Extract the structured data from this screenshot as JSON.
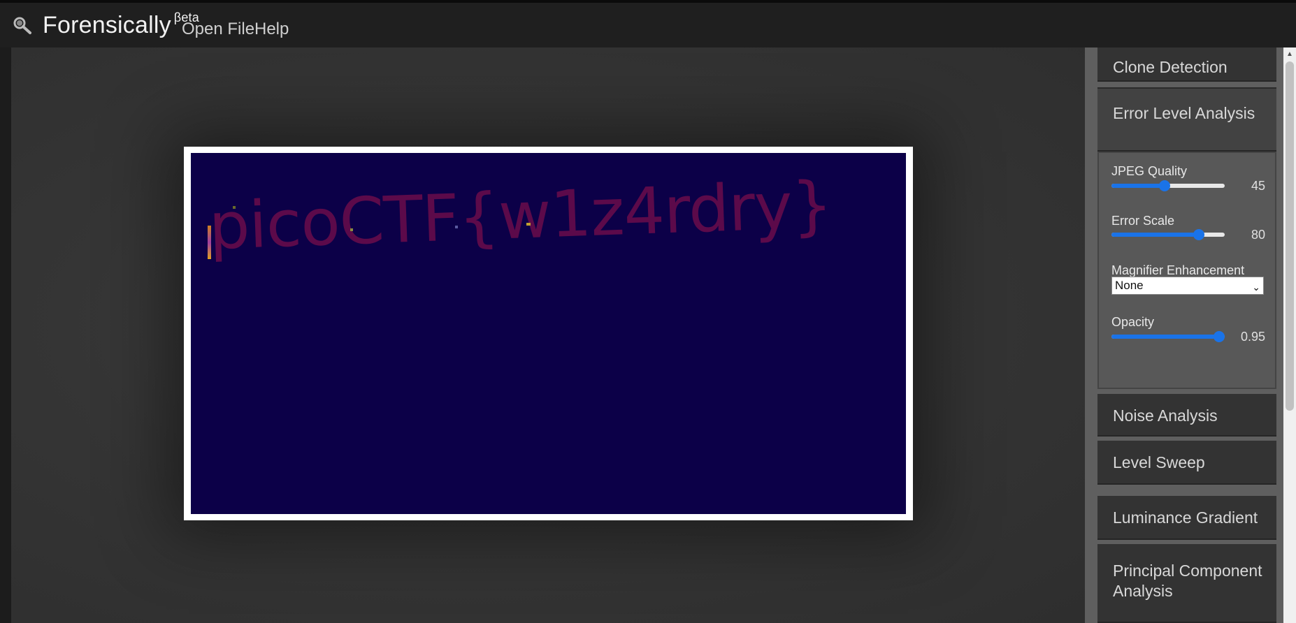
{
  "app": {
    "title": "Forensically",
    "badge": "βeta"
  },
  "menu": {
    "open_file": "Open File",
    "help": "Help"
  },
  "image": {
    "flag_text": "picoCTF{w1z4rdry}"
  },
  "sidebar": {
    "clone_detection": "Clone Detection",
    "error_level_analysis": "Error Level Analysis",
    "ela": {
      "jpeg_quality": {
        "label": "JPEG Quality",
        "value": "45",
        "fraction": 0.47
      },
      "error_scale": {
        "label": "Error Scale",
        "value": "80",
        "fraction": 0.77
      },
      "magnifier": {
        "label": "Magnifier Enhancement",
        "selected": "None"
      },
      "opacity": {
        "label": "Opacity",
        "value": "0.95",
        "fraction": 0.95
      }
    },
    "noise_analysis": "Noise Analysis",
    "level_sweep": "Level Sweep",
    "luminance_gradient": "Luminance Gradient",
    "principal_component_analysis": "Principal Component Analysis"
  },
  "colors": {
    "accent": "#1a73e8",
    "image_bg": "#0c0048",
    "flag": "#5c0a4a"
  }
}
